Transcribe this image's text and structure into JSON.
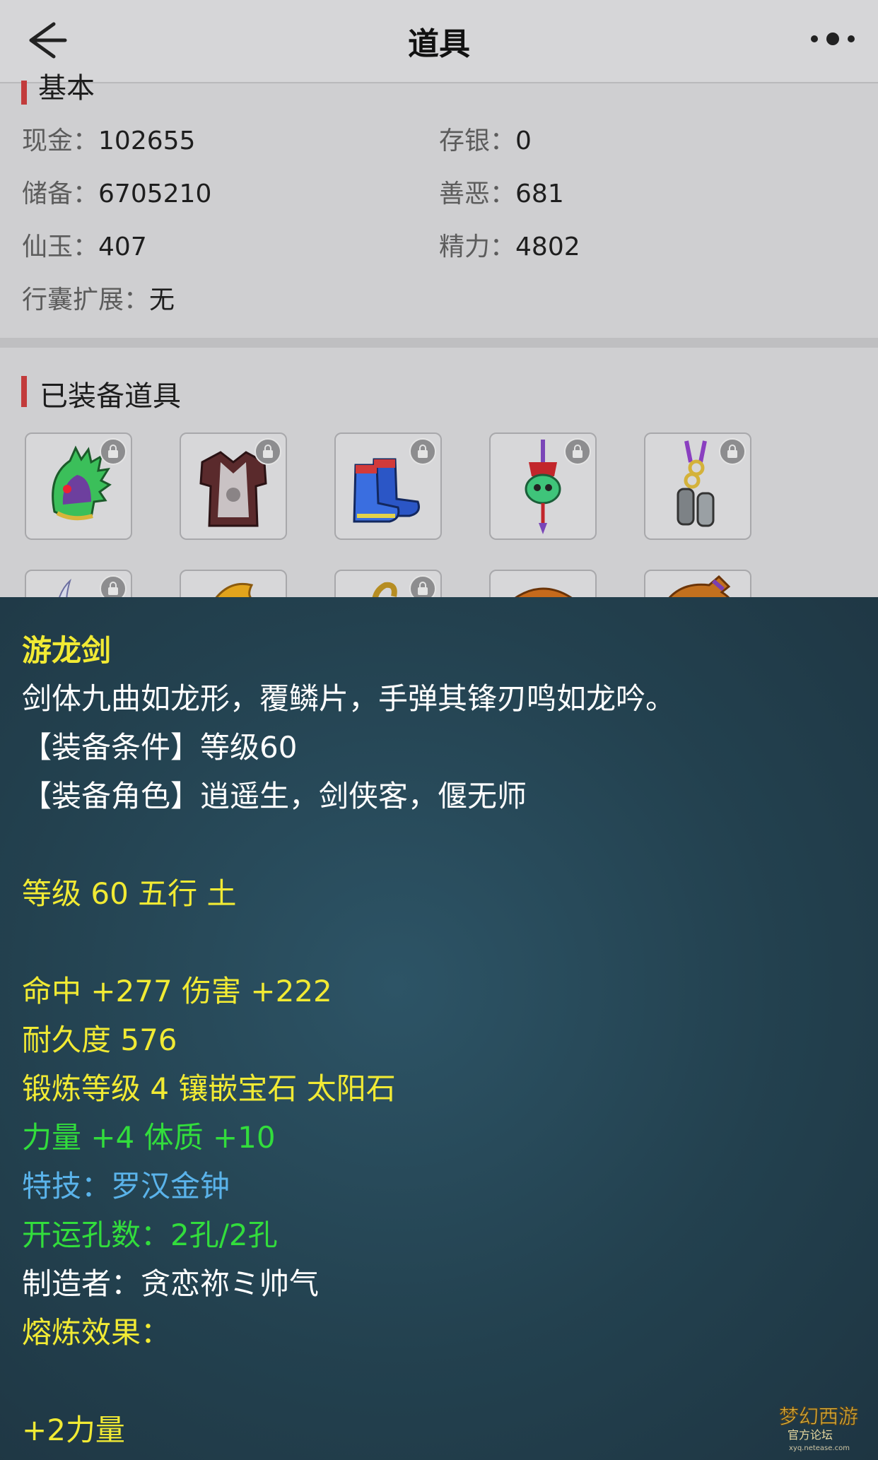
{
  "nav": {
    "title": "道具"
  },
  "basic": {
    "section_title": "基本",
    "cash_label": "现金：",
    "cash": "102655",
    "deposit_label": "存银：",
    "deposit": "0",
    "reserve_label": "储备：",
    "reserve": "6705210",
    "karma_label": "善恶：",
    "karma": "681",
    "jade_label": "仙玉：",
    "jade": "407",
    "energy_label": "精力：",
    "energy": "4802",
    "bag_label": "行囊扩展：",
    "bag": "无"
  },
  "equipped": {
    "section_title": "已装备道具",
    "items": [
      "helmet-icon",
      "armor-icon",
      "boots-icon",
      "skull-amulet-icon",
      "chain-belt-icon",
      "blade-icon",
      "leaf-icon",
      "serpent-icon",
      "hat-icon",
      "gourd-icon"
    ]
  },
  "tooltip": {
    "name": "游龙剑",
    "description": "剑体九曲如龙形，覆鳞片，手弹其锋刃鸣如龙吟。",
    "requirement": "【装备条件】等级60",
    "roles": "【装备角色】逍遥生，剑侠客，偃无师",
    "level_element": "等级 60 五行 土",
    "hit_damage": "命中 +277 伤害 +222",
    "durability": "耐久度 576",
    "forge": "锻炼等级 4 镶嵌宝石 太阳石",
    "stats": "力量 +4 体质 +10",
    "skill": "特技：罗汉金钟",
    "luck_holes": "开运孔数：2孔/2孔",
    "maker": "制造者：贪恋祢ミ帅气",
    "smelt": "熔炼效果：",
    "smelt_bonus": "+2力量"
  },
  "watermark": {
    "text": "梦幻西游",
    "sub": "官方论坛",
    "url": "xyq.netease.com"
  },
  "colors": {
    "yellow": "#f1ea34",
    "green": "#32dd3c",
    "blue": "#5ab3ea",
    "accent": "#c23b3b"
  }
}
